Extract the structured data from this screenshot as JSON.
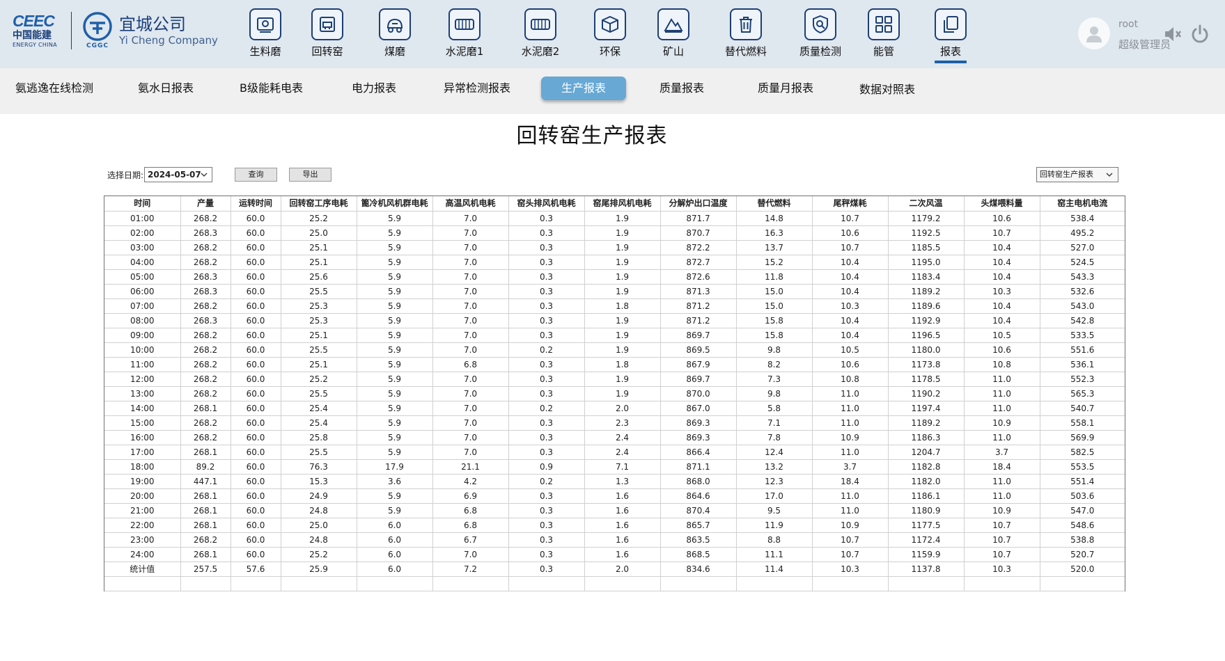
{
  "brand": {
    "ce_mark": "CEEC",
    "ce_cn": "中国能建",
    "ce_en": "ENERGY CHINA",
    "cggc_en": "CGGC",
    "company_cn": "宜城公司",
    "company_en": "Yi Cheng Company",
    "color": "#1b3f7a"
  },
  "nav": {
    "items": [
      {
        "label": "生料磨",
        "icon": "raw-mill-icon"
      },
      {
        "label": "回转窑",
        "icon": "rotary-kiln-icon"
      },
      {
        "label": "煤磨",
        "icon": "coal-mill-icon"
      },
      {
        "label": "水泥磨1",
        "icon": "cement-mill-icon"
      },
      {
        "label": "水泥磨2",
        "icon": "cement-mill-icon"
      },
      {
        "label": "环保",
        "icon": "box-icon"
      },
      {
        "label": "矿山",
        "icon": "mountain-icon"
      },
      {
        "label": "替代燃料",
        "icon": "trash-icon"
      },
      {
        "label": "质量检测",
        "icon": "shield-search-icon"
      },
      {
        "label": "能管",
        "icon": "grid-icon"
      },
      {
        "label": "报表",
        "icon": "copy-icon"
      }
    ],
    "active": "报表",
    "accent": "#1d5fa6"
  },
  "user": {
    "name": "root",
    "role": "超级管理员"
  },
  "subnav": {
    "tabs": [
      "氨逃逸在线检测",
      "氨水日报表",
      "B级能耗电表",
      "电力报表",
      "异常检测报表",
      "生产报表",
      "质量报表",
      "质量月报表",
      "数据对照表"
    ],
    "active": "生产报表",
    "active_color": "#67a8d4"
  },
  "report": {
    "title": "回转窑生产报表",
    "date_label": "选择日期:",
    "date_value": "2024-05-07",
    "query_label": "查询",
    "export_label": "导出",
    "report_type": "回转窑生产报表"
  },
  "table": {
    "headers": [
      "时间",
      "产量",
      "运转时间",
      "回转窑工序电耗",
      "篦冷机风机群电耗",
      "高温风机电耗",
      "窑头排风机电耗",
      "窑尾排风机电耗",
      "分解炉出口温度",
      "替代燃料",
      "尾秤煤耗",
      "二次风温",
      "头煤喂料量",
      "窑主电机电流"
    ],
    "rows": [
      [
        "01:00",
        "268.2",
        "60.0",
        "25.2",
        "5.9",
        "7.0",
        "0.3",
        "1.9",
        "871.7",
        "14.8",
        "10.7",
        "1179.2",
        "10.6",
        "538.4"
      ],
      [
        "02:00",
        "268.3",
        "60.0",
        "25.0",
        "5.9",
        "7.0",
        "0.3",
        "1.9",
        "870.7",
        "16.3",
        "10.6",
        "1192.5",
        "10.7",
        "495.2"
      ],
      [
        "03:00",
        "268.2",
        "60.0",
        "25.1",
        "5.9",
        "7.0",
        "0.3",
        "1.9",
        "872.2",
        "13.7",
        "10.7",
        "1185.5",
        "10.4",
        "527.0"
      ],
      [
        "04:00",
        "268.2",
        "60.0",
        "25.1",
        "5.9",
        "7.0",
        "0.3",
        "1.9",
        "872.7",
        "15.2",
        "10.4",
        "1195.0",
        "10.4",
        "524.5"
      ],
      [
        "05:00",
        "268.3",
        "60.0",
        "25.6",
        "5.9",
        "7.0",
        "0.3",
        "1.9",
        "872.6",
        "11.8",
        "10.4",
        "1183.4",
        "10.4",
        "543.3"
      ],
      [
        "06:00",
        "268.3",
        "60.0",
        "25.5",
        "5.9",
        "7.0",
        "0.3",
        "1.9",
        "871.3",
        "15.0",
        "10.4",
        "1189.2",
        "10.3",
        "532.6"
      ],
      [
        "07:00",
        "268.2",
        "60.0",
        "25.3",
        "5.9",
        "7.0",
        "0.3",
        "1.8",
        "871.2",
        "15.0",
        "10.3",
        "1189.6",
        "10.4",
        "543.0"
      ],
      [
        "08:00",
        "268.3",
        "60.0",
        "25.3",
        "5.9",
        "7.0",
        "0.3",
        "1.9",
        "871.2",
        "15.8",
        "10.4",
        "1192.9",
        "10.4",
        "542.8"
      ],
      [
        "09:00",
        "268.2",
        "60.0",
        "25.1",
        "5.9",
        "7.0",
        "0.3",
        "1.9",
        "869.7",
        "15.8",
        "10.4",
        "1196.5",
        "10.5",
        "533.5"
      ],
      [
        "10:00",
        "268.2",
        "60.0",
        "25.5",
        "5.9",
        "7.0",
        "0.2",
        "1.9",
        "869.5",
        "9.8",
        "10.5",
        "1180.0",
        "10.6",
        "551.6"
      ],
      [
        "11:00",
        "268.2",
        "60.0",
        "25.1",
        "5.9",
        "6.8",
        "0.3",
        "1.8",
        "867.9",
        "8.2",
        "10.6",
        "1173.8",
        "10.8",
        "536.1"
      ],
      [
        "12:00",
        "268.2",
        "60.0",
        "25.2",
        "5.9",
        "7.0",
        "0.3",
        "1.9",
        "869.7",
        "7.3",
        "10.8",
        "1178.5",
        "11.0",
        "552.3"
      ],
      [
        "13:00",
        "268.2",
        "60.0",
        "25.5",
        "5.9",
        "7.0",
        "0.3",
        "1.9",
        "870.0",
        "9.8",
        "11.0",
        "1190.2",
        "11.0",
        "565.3"
      ],
      [
        "14:00",
        "268.1",
        "60.0",
        "25.4",
        "5.9",
        "7.0",
        "0.2",
        "2.0",
        "867.0",
        "5.8",
        "11.0",
        "1197.4",
        "11.0",
        "540.7"
      ],
      [
        "15:00",
        "268.2",
        "60.0",
        "25.4",
        "5.9",
        "7.0",
        "0.3",
        "2.3",
        "869.3",
        "7.1",
        "11.0",
        "1189.2",
        "10.9",
        "558.1"
      ],
      [
        "16:00",
        "268.2",
        "60.0",
        "25.8",
        "5.9",
        "7.0",
        "0.3",
        "2.4",
        "869.3",
        "7.8",
        "10.9",
        "1186.3",
        "11.0",
        "569.9"
      ],
      [
        "17:00",
        "268.1",
        "60.0",
        "25.5",
        "5.9",
        "7.0",
        "0.3",
        "2.4",
        "866.4",
        "12.4",
        "11.0",
        "1204.7",
        "3.7",
        "582.5"
      ],
      [
        "18:00",
        "89.2",
        "60.0",
        "76.3",
        "17.9",
        "21.1",
        "0.9",
        "7.1",
        "871.1",
        "13.2",
        "3.7",
        "1182.8",
        "18.4",
        "553.5"
      ],
      [
        "19:00",
        "447.1",
        "60.0",
        "15.3",
        "3.6",
        "4.2",
        "0.2",
        "1.3",
        "868.0",
        "12.3",
        "18.4",
        "1182.0",
        "11.0",
        "551.4"
      ],
      [
        "20:00",
        "268.1",
        "60.0",
        "24.9",
        "5.9",
        "6.9",
        "0.3",
        "1.6",
        "864.6",
        "17.0",
        "11.0",
        "1186.1",
        "11.0",
        "503.6"
      ],
      [
        "21:00",
        "268.1",
        "60.0",
        "24.8",
        "5.9",
        "6.8",
        "0.3",
        "1.6",
        "870.4",
        "9.5",
        "11.0",
        "1180.9",
        "10.9",
        "547.0"
      ],
      [
        "22:00",
        "268.1",
        "60.0",
        "25.0",
        "6.0",
        "6.8",
        "0.3",
        "1.6",
        "865.7",
        "11.9",
        "10.9",
        "1177.5",
        "10.7",
        "548.6"
      ],
      [
        "23:00",
        "268.2",
        "60.0",
        "24.8",
        "6.0",
        "6.7",
        "0.3",
        "1.6",
        "863.5",
        "8.8",
        "10.7",
        "1172.4",
        "10.7",
        "538.8"
      ],
      [
        "24:00",
        "268.1",
        "60.0",
        "25.2",
        "6.0",
        "7.0",
        "0.3",
        "1.6",
        "868.5",
        "11.1",
        "10.7",
        "1159.9",
        "10.7",
        "520.7"
      ],
      [
        "统计值",
        "257.5",
        "57.6",
        "25.9",
        "6.0",
        "7.2",
        "0.3",
        "2.0",
        "834.6",
        "11.4",
        "10.3",
        "1137.8",
        "10.3",
        "520.0"
      ]
    ]
  }
}
